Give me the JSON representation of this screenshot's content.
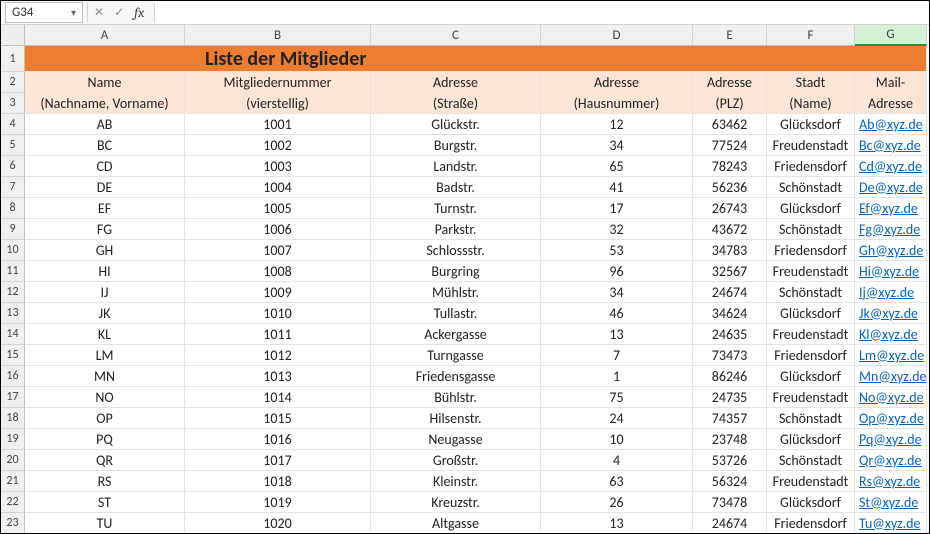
{
  "active_cell": "G34",
  "formula_value": "",
  "columns": [
    "A",
    "B",
    "C",
    "D",
    "E",
    "F",
    "G"
  ],
  "selected_col_index": 6,
  "row_numbers": [
    1,
    2,
    3,
    4,
    5,
    6,
    7,
    8,
    9,
    10,
    11,
    12,
    13,
    14,
    15,
    16,
    17,
    18,
    19,
    20,
    21,
    22,
    23
  ],
  "title": "Liste der Mitglieder",
  "headers_line1": [
    "Name",
    "Mitgliedernummer",
    "Adresse",
    "Adresse",
    "Adresse",
    "Stadt",
    "Mail-"
  ],
  "headers_line2": [
    "(Nachname, Vorname)",
    "(vierstellig)",
    "(Straße)",
    "(Hausnummer)",
    "(PLZ)",
    "(Name)",
    "Adresse"
  ],
  "rows": [
    {
      "name": "AB",
      "num": "1001",
      "street": "Glückstr.",
      "hn": "12",
      "plz": "63462",
      "city": "Glücksdorf",
      "mail": "Ab@xyz.de"
    },
    {
      "name": "BC",
      "num": "1002",
      "street": "Burgstr.",
      "hn": "34",
      "plz": "77524",
      "city": "Freudenstadt",
      "mail": "Bc@xyz.de"
    },
    {
      "name": "CD",
      "num": "1003",
      "street": "Landstr.",
      "hn": "65",
      "plz": "78243",
      "city": "Friedensdorf",
      "mail": "Cd@xyz.de"
    },
    {
      "name": "DE",
      "num": "1004",
      "street": "Badstr.",
      "hn": "41",
      "plz": "56236",
      "city": "Schönstadt",
      "mail": "De@xyz.de"
    },
    {
      "name": "EF",
      "num": "1005",
      "street": "Turnstr.",
      "hn": "17",
      "plz": "26743",
      "city": "Glücksdorf",
      "mail": "Ef@xyz.de"
    },
    {
      "name": "FG",
      "num": "1006",
      "street": "Parkstr.",
      "hn": "32",
      "plz": "43672",
      "city": "Schönstadt",
      "mail": "Fg@xyz.de"
    },
    {
      "name": "GH",
      "num": "1007",
      "street": "Schlossstr.",
      "hn": "53",
      "plz": "34783",
      "city": "Friedensdorf",
      "mail": "Gh@xyz.de"
    },
    {
      "name": "HI",
      "num": "1008",
      "street": "Burgring",
      "hn": "96",
      "plz": "32567",
      "city": "Freudenstadt",
      "mail": "Hi@xyz.de"
    },
    {
      "name": "IJ",
      "num": "1009",
      "street": "Mühlstr.",
      "hn": "34",
      "plz": "24674",
      "city": "Schönstadt",
      "mail": "Ij@xyz.de"
    },
    {
      "name": "JK",
      "num": "1010",
      "street": "Tullastr.",
      "hn": "46",
      "plz": "34624",
      "city": "Glücksdorf",
      "mail": "Jk@xyz.de"
    },
    {
      "name": "KL",
      "num": "1011",
      "street": "Ackergasse",
      "hn": "13",
      "plz": "24635",
      "city": "Freudenstadt",
      "mail": "Kl@xyz.de"
    },
    {
      "name": "LM",
      "num": "1012",
      "street": "Turngasse",
      "hn": "7",
      "plz": "73473",
      "city": "Friedensdorf",
      "mail": "Lm@xyz.de"
    },
    {
      "name": "MN",
      "num": "1013",
      "street": "Friedensgasse",
      "hn": "1",
      "plz": "86246",
      "city": "Glücksdorf",
      "mail": "Mn@xyz.de"
    },
    {
      "name": "NO",
      "num": "1014",
      "street": "Bühlstr.",
      "hn": "75",
      "plz": "24735",
      "city": "Freudenstadt",
      "mail": "No@xyz.de"
    },
    {
      "name": "OP",
      "num": "1015",
      "street": "Hilsenstr.",
      "hn": "24",
      "plz": "74357",
      "city": "Schönstadt",
      "mail": "Op@xyz.de"
    },
    {
      "name": "PQ",
      "num": "1016",
      "street": "Neugasse",
      "hn": "10",
      "plz": "23748",
      "city": "Glücksdorf",
      "mail": "Pq@xyz.de"
    },
    {
      "name": "QR",
      "num": "1017",
      "street": "Großstr.",
      "hn": "4",
      "plz": "53726",
      "city": "Schönstadt",
      "mail": "Qr@xyz.de"
    },
    {
      "name": "RS",
      "num": "1018",
      "street": "Kleinstr.",
      "hn": "63",
      "plz": "56324",
      "city": "Freudenstadt",
      "mail": "Rs@xyz.de"
    },
    {
      "name": "ST",
      "num": "1019",
      "street": "Kreuzstr.",
      "hn": "26",
      "plz": "73478",
      "city": "Glücksdorf",
      "mail": "St@xyz.de"
    },
    {
      "name": "TU",
      "num": "1020",
      "street": "Altgasse",
      "hn": "13",
      "plz": "24674",
      "city": "Friedensdorf",
      "mail": "Tu@xyz.de"
    }
  ],
  "icons": {
    "dropdown": "▾",
    "cancel": "✕",
    "confirm": "✓"
  },
  "fx_label": "fx"
}
